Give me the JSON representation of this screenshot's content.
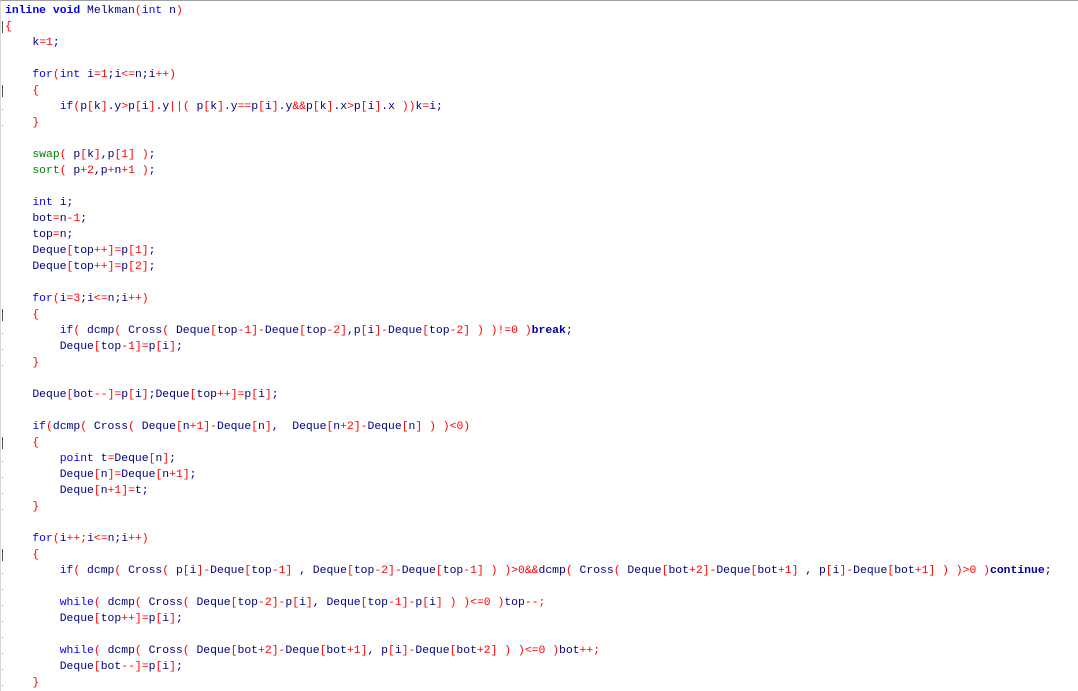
{
  "editor": {
    "language": "cpp",
    "colors": {
      "keyword": "#0000ff",
      "keyword_bold": "#0000a0",
      "builtin_function": "#008000",
      "number": "#ff0000",
      "operator": "#ff0000",
      "bracket": "#ff0000",
      "identifier": "#000080"
    },
    "lines": [
      "inline void Melkman(int n)",
      "{",
      "    k=1;",
      "",
      "    for(int i=1;i<=n;i++)",
      "    {",
      "        if(p[k].y>p[i].y||( p[k].y==p[i].y&&p[k].x>p[i].x ))k=i;",
      "    }",
      "",
      "    swap( p[k],p[1] );",
      "    sort( p+2,p+n+1 );",
      "",
      "    int i;",
      "    bot=n-1;",
      "    top=n;",
      "    Deque[top++]=p[1];",
      "    Deque[top++]=p[2];",
      "",
      "    for(i=3;i<=n;i++)",
      "    {",
      "        if( dcmp( Cross( Deque[top-1]-Deque[top-2],p[i]-Deque[top-2] ) )!=0 )break;",
      "        Deque[top-1]=p[i];",
      "    }",
      "",
      "    Deque[bot--]=p[i];Deque[top++]=p[i];",
      "",
      "    if(dcmp( Cross( Deque[n+1]-Deque[n],  Deque[n+2]-Deque[n] ) )<0)",
      "    {",
      "        point t=Deque[n];",
      "        Deque[n]=Deque[n+1];",
      "        Deque[n+1]=t;",
      "    }",
      "",
      "    for(i++;i<=n;i++)",
      "    {",
      "        if( dcmp( Cross( p[i]-Deque[top-1] , Deque[top-2]-Deque[top-1] ) )>0&&dcmp( Cross( Deque[bot+2]-Deque[bot+1] , p[i]-Deque[bot+1] ) )>0 )continue;",
      "",
      "        while( dcmp( Cross( Deque[top-2]-p[i], Deque[top-1]-p[i] ) )<=0 )top--;",
      "        Deque[top++]=p[i];",
      "",
      "        while( dcmp( Cross( Deque[bot+2]-Deque[bot+1], p[i]-Deque[bot+2] ) )<=0 )bot++;",
      "        Deque[bot--]=p[i];",
      "    }"
    ],
    "fold_markers": [
      1,
      5,
      19,
      27,
      34
    ],
    "fold_dots": [
      6,
      7,
      20,
      21,
      22,
      28,
      29,
      30,
      31,
      35,
      36,
      37,
      38,
      39,
      40,
      41,
      42
    ]
  }
}
